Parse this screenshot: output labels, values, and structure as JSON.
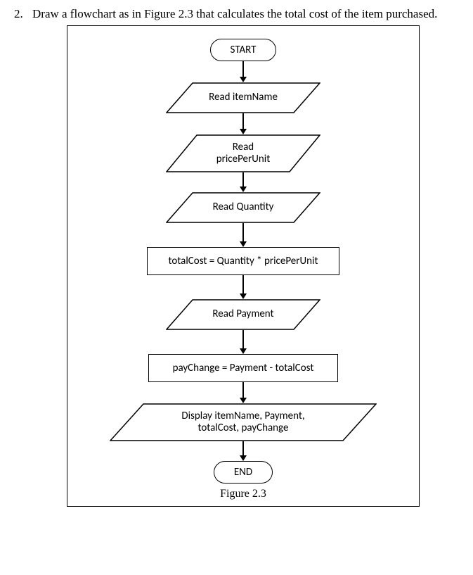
{
  "question": {
    "number": "2.",
    "text": "Draw a flowchart as in Figure 2.3 that calculates the total cost of the item purchased."
  },
  "chart_data": {
    "type": "flowchart",
    "title": "Figure 2.3",
    "nodes": [
      {
        "id": "n1",
        "shape": "terminator",
        "text": "START"
      },
      {
        "id": "n2",
        "shape": "parallelogram",
        "text": "Read itemName"
      },
      {
        "id": "n3",
        "shape": "parallelogram",
        "text": "Read pricePerUnit"
      },
      {
        "id": "n4",
        "shape": "parallelogram",
        "text": "Read Quantity"
      },
      {
        "id": "n5",
        "shape": "rectangle",
        "text": "totalCost = Quantity * pricePerUnit"
      },
      {
        "id": "n6",
        "shape": "parallelogram",
        "text": "Read Payment"
      },
      {
        "id": "n7",
        "shape": "rectangle",
        "text": "payChange = Payment - totalCost"
      },
      {
        "id": "n8",
        "shape": "parallelogram",
        "text": "Display itemName, Payment, totalCost, payChange"
      },
      {
        "id": "n9",
        "shape": "terminator",
        "text": "END"
      }
    ],
    "edges": [
      [
        "n1",
        "n2"
      ],
      [
        "n2",
        "n3"
      ],
      [
        "n3",
        "n4"
      ],
      [
        "n4",
        "n5"
      ],
      [
        "n5",
        "n6"
      ],
      [
        "n6",
        "n7"
      ],
      [
        "n7",
        "n8"
      ],
      [
        "n8",
        "n9"
      ]
    ]
  },
  "nodes": {
    "start": "START",
    "read_item": "Read itemName",
    "read_price_l1": "Read",
    "read_price_l2": "pricePerUnit",
    "read_qty": "Read Quantity",
    "calc_total": "totalCost = Quantity * pricePerUnit",
    "read_pay": "Read Payment",
    "calc_change": "payChange = Payment - totalCost",
    "display_l1": "Display itemName, Payment,",
    "display_l2": "totalCost, payChange",
    "end": "END"
  },
  "caption": "Figure 2.3"
}
